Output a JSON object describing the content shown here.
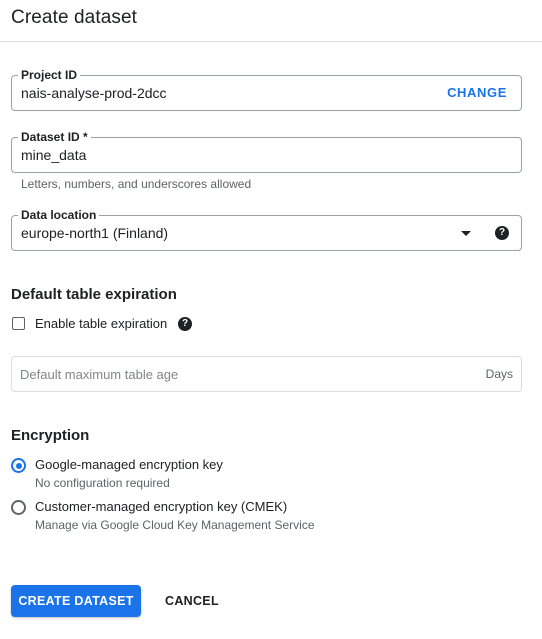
{
  "dialog": {
    "title": "Create dataset"
  },
  "project": {
    "label": "Project ID",
    "value": "nais-analyse-prod-2dcc",
    "change_label": "CHANGE"
  },
  "dataset": {
    "label": "Dataset ID *",
    "value": "mine_data",
    "hint": "Letters, numbers, and underscores allowed"
  },
  "location": {
    "label": "Data location",
    "value": "europe-north1 (Finland)",
    "icons": [
      "dropdown-arrow-icon",
      "help-icon"
    ]
  },
  "expiration": {
    "title": "Default table expiration",
    "checkbox_label": "Enable table expiration",
    "checked": false,
    "age_placeholder": "Default maximum table age",
    "unit": "Days"
  },
  "encryption": {
    "title": "Encryption",
    "options": [
      {
        "label": "Google-managed encryption key",
        "sub": "No configuration required",
        "selected": true
      },
      {
        "label": "Customer-managed encryption key (CMEK)",
        "sub": "Manage via Google Cloud Key Management Service",
        "selected": false
      }
    ]
  },
  "actions": {
    "create_label": "CREATE DATASET",
    "cancel_label": "CANCEL"
  },
  "colors": {
    "accent": "#1a73e8",
    "text": "#202124",
    "muted": "#5f6368",
    "border": "#dadce0"
  }
}
